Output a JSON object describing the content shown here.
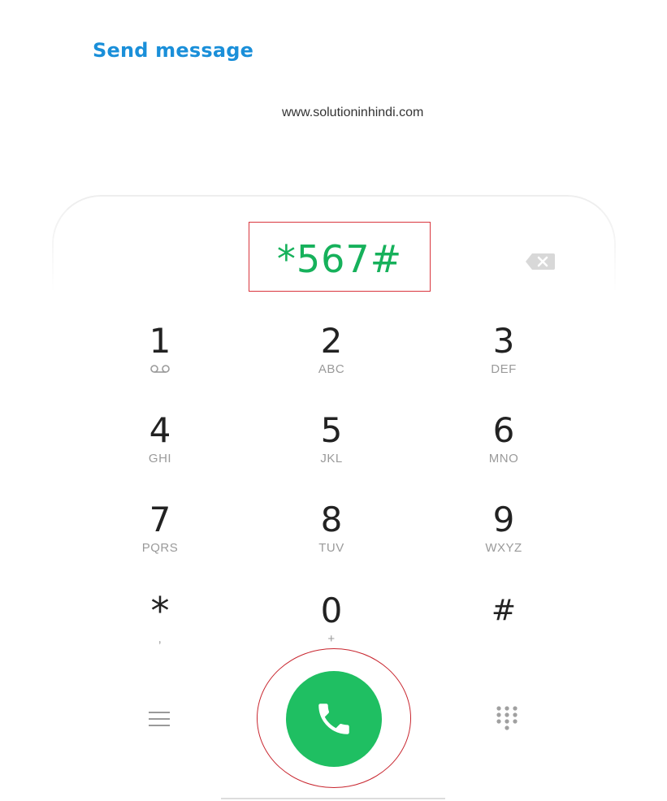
{
  "header": {
    "send_message_label": "Send message"
  },
  "watermark": {
    "text": "www.solutioninhindi.com"
  },
  "dialer": {
    "dialed_number": "*567#",
    "keys": [
      {
        "digit": "1",
        "letters": ""
      },
      {
        "digit": "2",
        "letters": "ABC"
      },
      {
        "digit": "3",
        "letters": "DEF"
      },
      {
        "digit": "4",
        "letters": "GHI"
      },
      {
        "digit": "5",
        "letters": "JKL"
      },
      {
        "digit": "6",
        "letters": "MNO"
      },
      {
        "digit": "7",
        "letters": "PQRS"
      },
      {
        "digit": "8",
        "letters": "TUV"
      },
      {
        "digit": "9",
        "letters": "WXYZ"
      },
      {
        "digit": "*",
        "letters": ","
      },
      {
        "digit": "0",
        "letters": "+"
      },
      {
        "digit": "#",
        "letters": ""
      }
    ]
  },
  "icons": {
    "backspace": "backspace-icon",
    "voicemail": "voicemail-icon",
    "call": "phone-icon",
    "menu": "menu-icon",
    "dialpad": "dialpad-icon"
  },
  "colors": {
    "link_blue": "#1a8fd9",
    "number_green": "#16b15b",
    "call_green": "#1fbf62",
    "highlight_red": "#c8252e"
  }
}
